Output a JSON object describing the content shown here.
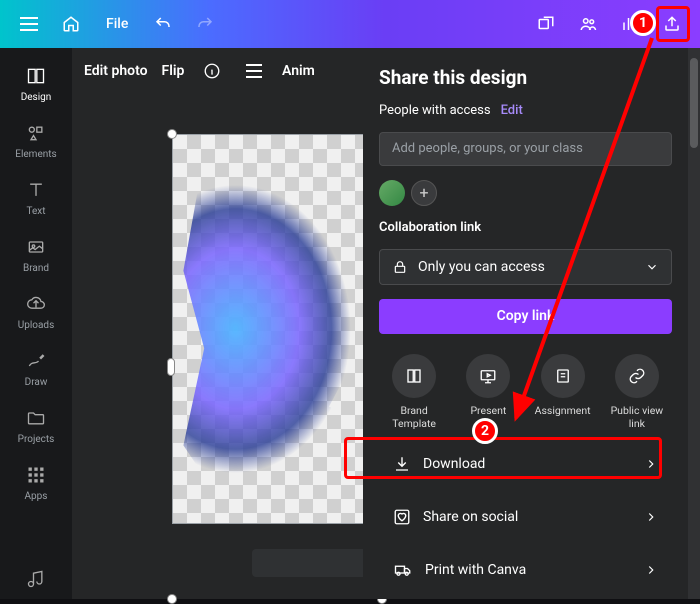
{
  "topbar": {
    "file_label": "File"
  },
  "sidebar": {
    "items": [
      {
        "label": "Design"
      },
      {
        "label": "Elements"
      },
      {
        "label": "Text"
      },
      {
        "label": "Brand"
      },
      {
        "label": "Uploads"
      },
      {
        "label": "Draw"
      },
      {
        "label": "Projects"
      },
      {
        "label": "Apps"
      }
    ]
  },
  "toolbar": {
    "edit_photo": "Edit photo",
    "flip": "Flip",
    "animate": "Anim"
  },
  "panel": {
    "title": "Share this design",
    "access_label": "People with access",
    "edit_label": "Edit",
    "add_placeholder": "Add people, groups, or your class",
    "collab_label": "Collaboration link",
    "dropdown_label": "Only you can access",
    "copy_label": "Copy link",
    "tiles": [
      {
        "label": "Brand\nTemplate"
      },
      {
        "label": "Present"
      },
      {
        "label": "Assignment"
      },
      {
        "label": "Public view\nlink"
      }
    ],
    "menu": [
      {
        "label": "Download"
      },
      {
        "label": "Share on social"
      },
      {
        "label": "Print with Canva"
      }
    ]
  },
  "annotations": {
    "marker1": "1",
    "marker2": "2"
  }
}
